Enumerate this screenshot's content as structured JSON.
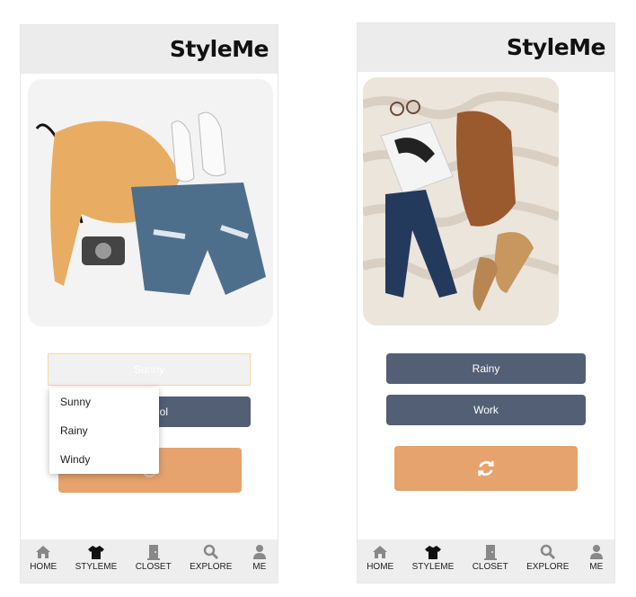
{
  "app": {
    "title": "StyleMe"
  },
  "screen1": {
    "select_value": "Sunny",
    "dropdown_options": [
      "Sunny",
      "Rainy",
      "Windy"
    ],
    "occasion_partial": "ol",
    "refresh_icon": "refresh-icon"
  },
  "screen2": {
    "weather_button": "Rainy",
    "occasion_button": "Work",
    "refresh_icon": "refresh-icon"
  },
  "nav": {
    "items": [
      {
        "label": "HOME",
        "icon": "home-icon"
      },
      {
        "label": "STYLEME",
        "icon": "shirt-icon"
      },
      {
        "label": "CLOSET",
        "icon": "closet-icon"
      },
      {
        "label": "EXPLORE",
        "icon": "search-icon"
      },
      {
        "label": "ME",
        "icon": "person-icon"
      }
    ]
  },
  "colors": {
    "header_bg": "#ececec",
    "slate_button": "#525f75",
    "orange_button": "#e6a36d",
    "nav_bg": "#eeeeee"
  }
}
